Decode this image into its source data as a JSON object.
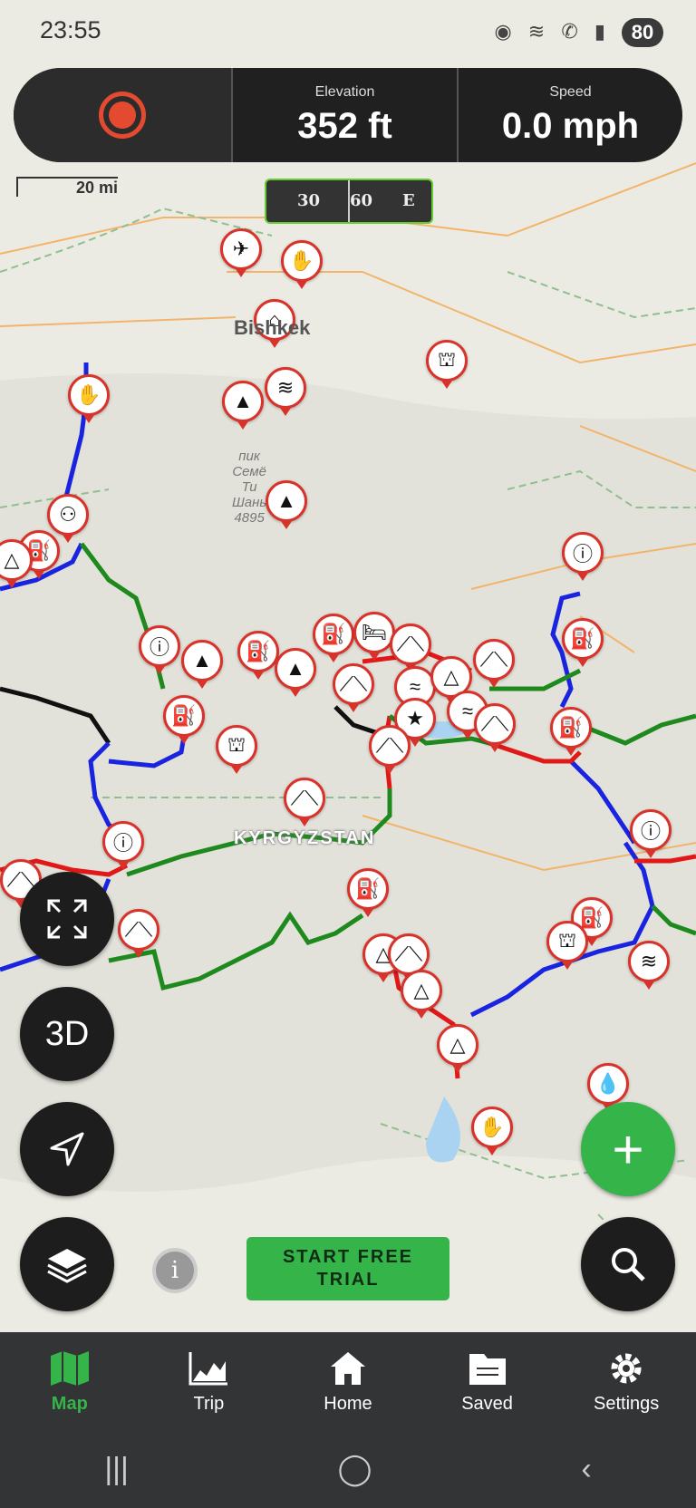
{
  "status": {
    "time": "23:55",
    "battery": "80"
  },
  "hud": {
    "record_button": "record",
    "elevation": {
      "label": "Elevation",
      "value": "352 ft"
    },
    "speed": {
      "label": "Speed",
      "value": "0.0 mph"
    }
  },
  "map": {
    "scale_label": "20 mi",
    "compass": {
      "t1": "30",
      "t2": "60",
      "t3": "E"
    },
    "city_label": "Bishkek",
    "peak_label": [
      "пик",
      "Семё",
      "Ти",
      "Шань",
      "4895"
    ],
    "country_label": "KYRGYZSTAN"
  },
  "controls": {
    "fullscreen": "fullscreen",
    "three_d": "3D",
    "locate": "locate",
    "layers": "layers",
    "add": "+",
    "search": "search",
    "info": "i"
  },
  "trial_button": {
    "line1": "START FREE",
    "line2": "TRIAL"
  },
  "navbar": [
    {
      "label": "Map",
      "icon": "map-icon"
    },
    {
      "label": "Trip",
      "icon": "chart-icon"
    },
    {
      "label": "Home",
      "icon": "home-icon"
    },
    {
      "label": "Saved",
      "icon": "folder-icon"
    },
    {
      "label": "Settings",
      "icon": "gear-icon"
    }
  ],
  "colors": {
    "accent": "#35b44a",
    "pin_border": "#d8332a",
    "route_red": "#e01818",
    "route_blue": "#1a24e0",
    "route_green": "#1e8a1e"
  }
}
